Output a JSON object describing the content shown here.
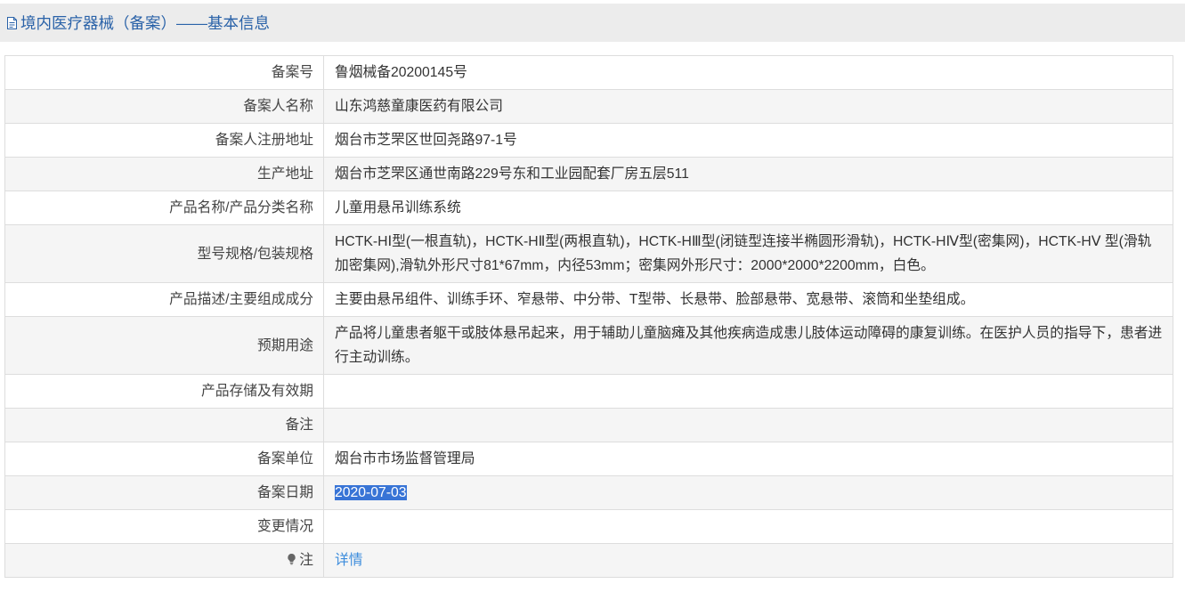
{
  "header": {
    "icon": "document-icon",
    "title": "境内医疗器械（备案）——基本信息"
  },
  "colors": {
    "title_color": "#2a62a8",
    "link_color": "#3a8bdc",
    "selection_bg": "#3874d6",
    "alt_row_bg": "#f5f5f5",
    "header_bg": "#ececec",
    "border_color": "#dddddd"
  },
  "rows": [
    {
      "label": "备案号",
      "value": "鲁烟械备20200145号"
    },
    {
      "label": "备案人名称",
      "value": "山东鸿慈童康医药有限公司"
    },
    {
      "label": "备案人注册地址",
      "value": "烟台市芝罘区世回尧路97-1号"
    },
    {
      "label": "生产地址",
      "value": "烟台市芝罘区通世南路229号东和工业园配套厂房五层511"
    },
    {
      "label": "产品名称/产品分类名称",
      "value": "儿童用悬吊训练系统"
    },
    {
      "label": "型号规格/包装规格",
      "value": "HCTK-HⅠ型(一根直轨)，HCTK-HⅡ型(两根直轨)，HCTK-HⅢ型(闭链型连接半椭圆形滑轨)，HCTK-HⅣ型(密集网)，HCTK-HⅤ 型(滑轨加密集网),滑轨外形尺寸81*67mm，内径53mm；密集网外形尺寸：2000*2000*2200mm，白色。"
    },
    {
      "label": "产品描述/主要组成成分",
      "value": "主要由悬吊组件、训练手环、窄悬带、中分带、T型带、长悬带、脸部悬带、宽悬带、滚筒和坐垫组成。"
    },
    {
      "label": "预期用途",
      "value": "产品将儿童患者躯干或肢体悬吊起来，用于辅助儿童脑瘫及其他疾病造成患儿肢体运动障碍的康复训练。在医护人员的指导下，患者进行主动训练。"
    },
    {
      "label": "产品存储及有效期",
      "value": ""
    },
    {
      "label": "备注",
      "value": ""
    },
    {
      "label": "备案单位",
      "value": "烟台市市场监督管理局"
    },
    {
      "label": "备案日期",
      "value": "2020-07-03",
      "selected": true
    },
    {
      "label": "变更情况",
      "value": ""
    },
    {
      "label": "注",
      "icon": "lightbulb-icon",
      "value": "详情"
    }
  ]
}
